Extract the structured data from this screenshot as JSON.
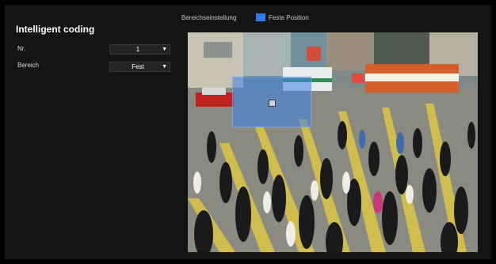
{
  "page": {
    "title": "Intelligent coding"
  },
  "form": {
    "nr_label": "Nr.",
    "nr_value": "1",
    "bereich_label": "Bereich",
    "bereich_value": "Fest"
  },
  "preview": {
    "area_setting_label": "Bereichseinstellung",
    "legend_label": "Feste Position",
    "legend_color": "#2f7cf0"
  }
}
